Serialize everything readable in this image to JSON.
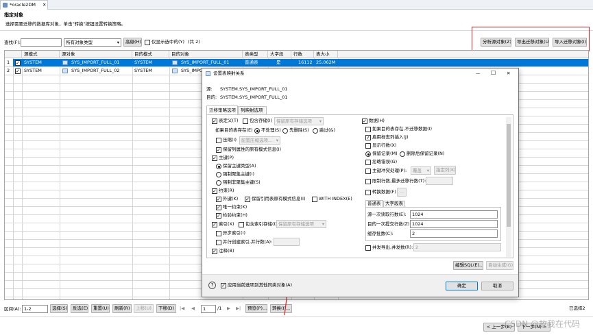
{
  "tab": {
    "title": "*oracle2DM"
  },
  "header": {
    "title": "指定对象",
    "subtitle": "选择需要迁移的数据库对象，单击\"转换\"按钮设置转换策略。"
  },
  "toolbar": {
    "search_label": "查找(F):",
    "search_value": "",
    "type_select": "所有对象类型",
    "advanced_button": "高级(H)",
    "only_selected_label": "仅显示选中的(Y)",
    "count_text": "(共 2)",
    "analyze_button": "分析源对象(Z)",
    "export_button": "导出迁移对象(U)",
    "import_button": "导入迁移对象(I)"
  },
  "table": {
    "headers": [
      "源模式",
      "源对象",
      "目的模式",
      "目的对象",
      "表类型",
      "大字段",
      "行数",
      "表大小"
    ],
    "rows": [
      {
        "no": "1",
        "src_schema": "SYSTEM",
        "src_object": "SYS_IMPORT_FULL_01",
        "dst_schema": "SYSTEM",
        "dst_object": "SYS_IMPORT_FULL_01",
        "table_type": "普通表",
        "lob": "是",
        "rows": "16112",
        "size": "25.062M"
      },
      {
        "no": "2",
        "src_schema": "SYSTEM",
        "src_object": "SYS_IMPORT_FULL_02",
        "dst_schema": "SYSTEM",
        "dst_object": "SYS_IMPORT_FULL_02",
        "table_type": "",
        "lob": "",
        "rows": "",
        "size": ""
      }
    ]
  },
  "bottom": {
    "range_label": "区间(A):",
    "range_value": "1-2",
    "select_button": "选择(S)",
    "invert_button": "反选(E)",
    "reset_button": "重置(U)",
    "refresh_button": "刷新(R)",
    "move_up_button": "上移(U)",
    "move_down_button": "下移(D)",
    "page_value": "1",
    "page_total": "/1",
    "preview_button": "预览(P)...",
    "convert_button": "转换(I)...",
    "selected_count": "已选择2",
    "prev_button": "< 上一步(B)",
    "next_button": "下一步(N) >",
    "watermark": "CSDN @故我在代码"
  },
  "dialog": {
    "title": "设置表映射关系",
    "source_label": "源:",
    "source_value": "SYSTEM.SYS_IMPORT_FULL_01",
    "dest_label": "目的:",
    "dest_value": "SYSTEM.SYS_IMPORT_FULL_01",
    "tabs": [
      "迁移策略选项",
      "列映射选项"
    ],
    "left": {
      "table_def": "表定义(T)",
      "include_storage": "包含存储(I)",
      "keep_storage_select": "保留原有存储选项",
      "if_exists": "如果目的表存在(E)",
      "no_handle": "不处理(S)",
      "drop_first": "先删除(S)",
      "skip": "跳过(&)",
      "compress": "压缩(I)",
      "compress_select": "配置压缩选项...",
      "keep_column_info": "保留列属性的原有模式信息(I)",
      "primary_key": "主键(P)",
      "keep_pk_type": "保留主键类型(A)",
      "force_clustered": "强制聚集主键(I)",
      "force_nonclustered": "强制非聚集主键(S)",
      "constraints": "约束(R)",
      "foreign_key": "外键(K)",
      "keep_ref_schema": "保留引用表原有模式信息(I)",
      "with_index": "WITH INDEX(E)",
      "unique": "唯一约束(K)",
      "check": "检验约束(H)",
      "index": "索引(X)",
      "include_index_storage": "包含索引存储(I)",
      "keep_index_select": "保留原有存储选项",
      "async_index": "异步索引(I)",
      "parallel_index": "并行创建索引,并行数(A):",
      "comment": "注释(B)"
    },
    "right": {
      "data": "数据(H)",
      "no_migrate_if_exists": "如果目的表存在,不迁移数据(I)",
      "enable_identity": "启用标志列插入(J)",
      "show_rows": "显示行数(X)",
      "keep_records": "保留记录(M)",
      "delete_then_keep": "删除后保留记录(N)",
      "ignore_errors": "忽略错误(G)",
      "pk_conflict": "主键冲突处理(P):",
      "pk_conflict_select": "覆盖",
      "specify_column": "指定列(K)",
      "limit_rows": "限制行数,最多迁移行数(T):",
      "convert_data": "转换数据(F)",
      "sub_tabs": [
        "普通表",
        "大字段表"
      ],
      "read_rows_label": "源一次读取行数(E):",
      "read_rows_value": "1024",
      "commit_rows_label": "目的一次提交行数(Z):",
      "commit_rows_value": "1024",
      "batch_label": "缓存批数(C):",
      "batch_value": "2",
      "parallel_export": "并发导出,并发数(R):",
      "parallel_value": "2"
    },
    "edit_sql_button": "编辑SQL(E)...",
    "auto_generate_button": "自动生成(G)",
    "apply_all_label": "应用当前选项到其他同类对象(A)",
    "ok_button": "确定",
    "cancel_button": "取消"
  },
  "colors": {
    "accent": "#0078d7",
    "highlight_border": "#e02020",
    "arrow": "#e02020"
  }
}
